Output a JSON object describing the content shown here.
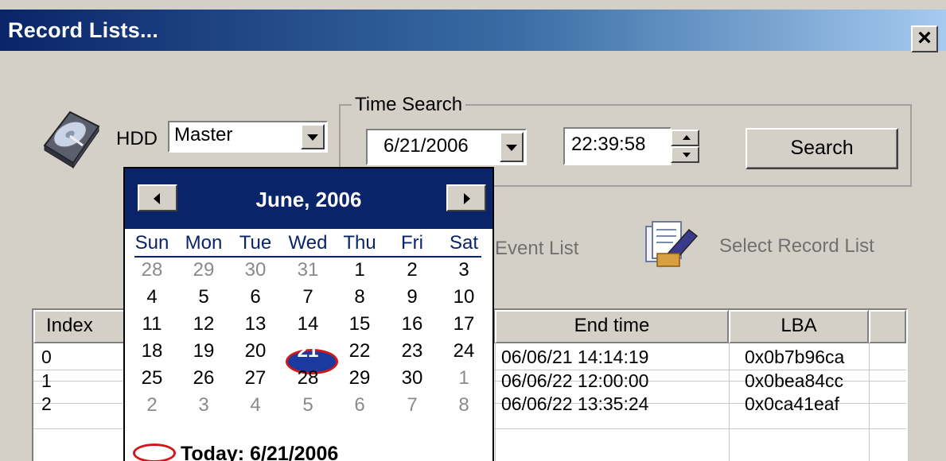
{
  "window": {
    "title": "Record Lists...",
    "close_label": "×"
  },
  "hdd": {
    "label": "HDD",
    "selected": "Master"
  },
  "time_search": {
    "group_title": "Time Search",
    "date_value": "6/21/2006",
    "time_value": "22:39:58",
    "search_label": "Search"
  },
  "actions": {
    "event_list_label": "Event List",
    "select_record_list_label": "Select Record List"
  },
  "table": {
    "columns": [
      "Index",
      "End time",
      "LBA"
    ],
    "rows": [
      {
        "index": "0",
        "end_time": "06/06/21  14:14:19",
        "lba": "0x0b7b96ca"
      },
      {
        "index": "1",
        "end_time": "06/06/22  12:00:00",
        "lba": "0x0bea84cc"
      },
      {
        "index": "2",
        "end_time": "06/06/22  13:35:24",
        "lba": "0x0ca41eaf"
      }
    ]
  },
  "calendar": {
    "month_title": "June, 2006",
    "weekdays": [
      "Sun",
      "Mon",
      "Tue",
      "Wed",
      "Thu",
      "Fri",
      "Sat"
    ],
    "weeks": [
      [
        "28",
        "29",
        "30",
        "31",
        "1",
        "2",
        "3"
      ],
      [
        "4",
        "5",
        "6",
        "7",
        "8",
        "9",
        "10"
      ],
      [
        "11",
        "12",
        "13",
        "14",
        "15",
        "16",
        "17"
      ],
      [
        "18",
        "19",
        "20",
        "21",
        "22",
        "23",
        "24"
      ],
      [
        "25",
        "26",
        "27",
        "28",
        "29",
        "30",
        "1"
      ],
      [
        "2",
        "3",
        "4",
        "5",
        "6",
        "7",
        "8"
      ]
    ],
    "selected_day": "21",
    "today_label": "Today: 6/21/2006"
  }
}
